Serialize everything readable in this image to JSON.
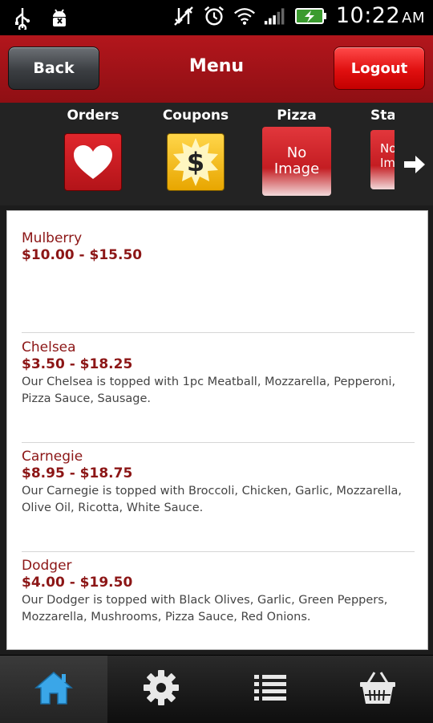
{
  "status_bar": {
    "time": "10:22",
    "ampm": "AM"
  },
  "header": {
    "back_label": "Back",
    "title": "Menu",
    "logout_label": "Logout"
  },
  "categories": [
    {
      "label": "Orders",
      "icon": "heart-icon"
    },
    {
      "label": "Coupons",
      "icon": "dollar-burst-icon"
    },
    {
      "label": "Pizza",
      "image_text_1": "No",
      "image_text_2": "Image"
    },
    {
      "label": "Star",
      "image_text_1": "No",
      "image_text_2": "Image"
    }
  ],
  "menu_items": [
    {
      "name": "Mulberry",
      "price": "$10.00 - $15.50",
      "description": ""
    },
    {
      "name": "Chelsea",
      "price": "$3.50 - $18.25",
      "description": "Our Chelsea is topped with 1pc Meatball, Mozzarella, Pepperoni, Pizza Sauce, Sausage."
    },
    {
      "name": "Carnegie",
      "price": "$8.95 - $18.75",
      "description": "Our Carnegie is topped with Broccoli, Chicken, Garlic, Mozzarella, Olive Oil, Ricotta, White Sauce."
    },
    {
      "name": "Dodger",
      "price": "$4.00 - $19.50",
      "description": "Our Dodger is topped with Black Olives, Garlic, Green Peppers, Mozzarella, Mushrooms, Pizza Sauce, Red Onions."
    }
  ],
  "bottom_nav": [
    {
      "icon": "home-icon",
      "active": true
    },
    {
      "icon": "gear-icon",
      "active": false
    },
    {
      "icon": "list-icon",
      "active": false
    },
    {
      "icon": "basket-icon",
      "active": false
    }
  ],
  "colors": {
    "brand_red": "#a8141a",
    "item_text": "#8c1616",
    "home_blue": "#3aa6e8"
  }
}
